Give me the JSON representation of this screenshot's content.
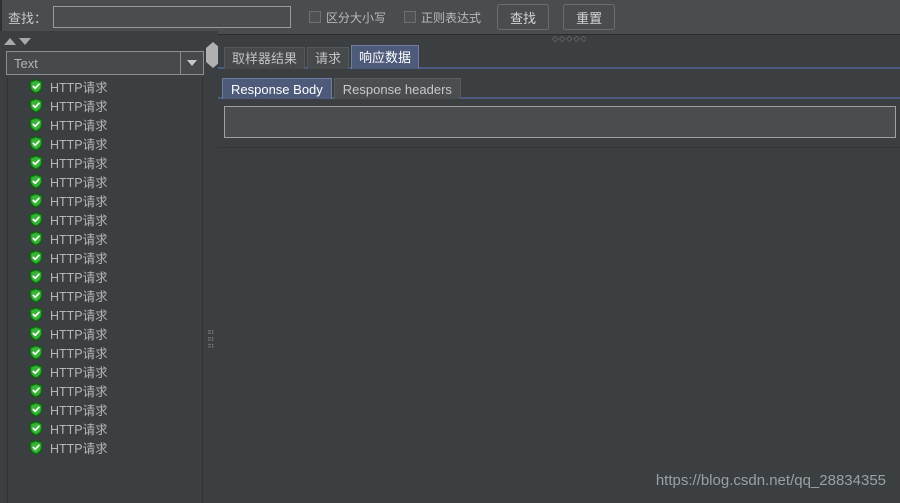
{
  "search_bar": {
    "find_label": "查找：",
    "find_input_value": "",
    "find_input_placeholder": "",
    "case_sensitive_label": "区分大小写",
    "case_sensitive_checked": false,
    "regex_label": "正则表达式",
    "regex_checked": false,
    "find_button": "查找",
    "reset_button": "重置",
    "splitter_grip": "◇◇◇◇◇"
  },
  "left_panel": {
    "sort_up_icon": "triangle-up-icon",
    "sort_down_icon": "triangle-down-icon",
    "combo_value": "Text",
    "combo_arrow_icon": "chevron-down-icon",
    "tree_items": [
      {
        "label": "HTTP请求",
        "status": "success"
      },
      {
        "label": "HTTP请求",
        "status": "success"
      },
      {
        "label": "HTTP请求",
        "status": "success"
      },
      {
        "label": "HTTP请求",
        "status": "success"
      },
      {
        "label": "HTTP请求",
        "status": "success"
      },
      {
        "label": "HTTP请求",
        "status": "success"
      },
      {
        "label": "HTTP请求",
        "status": "success"
      },
      {
        "label": "HTTP请求",
        "status": "success"
      },
      {
        "label": "HTTP请求",
        "status": "success"
      },
      {
        "label": "HTTP请求",
        "status": "success"
      },
      {
        "label": "HTTP请求",
        "status": "success"
      },
      {
        "label": "HTTP请求",
        "status": "success"
      },
      {
        "label": "HTTP请求",
        "status": "success"
      },
      {
        "label": "HTTP请求",
        "status": "success"
      },
      {
        "label": "HTTP请求",
        "status": "success"
      },
      {
        "label": "HTTP请求",
        "status": "success"
      },
      {
        "label": "HTTP请求",
        "status": "success"
      },
      {
        "label": "HTTP请求",
        "status": "success"
      },
      {
        "label": "HTTP请求",
        "status": "success"
      },
      {
        "label": "HTTP请求",
        "status": "success"
      }
    ]
  },
  "splitter": {
    "collapse_left_icon": "triangle-left-icon",
    "collapse_right_icon": "triangle-right-icon",
    "grip": "⣿⣿⣿"
  },
  "right_panel": {
    "tabs": [
      {
        "label": "取样器结果",
        "active": false
      },
      {
        "label": "请求",
        "active": false
      },
      {
        "label": "响应数据",
        "active": true
      }
    ],
    "sub_tabs": [
      {
        "label": "Response Body",
        "active": true
      },
      {
        "label": "Response headers",
        "active": false
      }
    ],
    "response_field_value": "",
    "response_body_content": ""
  },
  "watermark": "https://blog.csdn.net/qq_28834355",
  "colors": {
    "background": "#3c3f41",
    "toolbar": "#4a4d4f",
    "active_tab": "#4d5a7a",
    "tab_underline": "#4b5a82",
    "success_icon": "#29a329",
    "text": "#bbbbbb"
  }
}
